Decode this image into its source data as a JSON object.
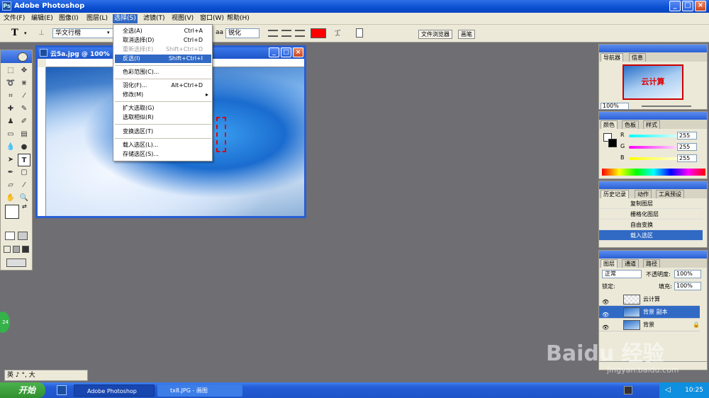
{
  "window": {
    "title": "Adobe Photoshop",
    "min": "_",
    "max": "□",
    "close": "×"
  },
  "menu": [
    "文件(F)",
    "编辑(E)",
    "图像(I)",
    "图层(L)",
    "选择(S)",
    "滤镜(T)",
    "视图(V)",
    "窗口(W)",
    "帮助(H)"
  ],
  "options": {
    "tool_glyph": "T",
    "font_family": "华文行楷",
    "antialias_label": "aa",
    "antialias": "锐化",
    "file_browser_tab": "文件浏览器",
    "brushes_tab": "画笔",
    "text_color": "#ff0000"
  },
  "document": {
    "title": "云5a.jpg @ 100%"
  },
  "select_menu": [
    {
      "label": "全选(A)",
      "shortcut": "Ctrl+A",
      "state": "normal"
    },
    {
      "label": "取消选择(D)",
      "shortcut": "Ctrl+D",
      "state": "normal"
    },
    {
      "label": "重新选择(E)",
      "shortcut": "Shift+Ctrl+D",
      "state": "disabled"
    },
    {
      "label": "反选(I)",
      "shortcut": "Shift+Ctrl+I",
      "state": "highlighted"
    },
    {
      "label": "色彩范围(C)...",
      "shortcut": "",
      "state": "normal"
    },
    {
      "label": "羽化(F)...",
      "shortcut": "Alt+Ctrl+D",
      "state": "normal"
    },
    {
      "label": "修改(M)",
      "shortcut": "▸",
      "state": "normal"
    },
    {
      "label": "扩大选取(G)",
      "shortcut": "",
      "state": "normal"
    },
    {
      "label": "选取相似(R)",
      "shortcut": "",
      "state": "normal"
    },
    {
      "label": "变换选区(T)",
      "shortcut": "",
      "state": "normal"
    },
    {
      "label": "载入选区(L)...",
      "shortcut": "",
      "state": "normal"
    },
    {
      "label": "存储选区(S)...",
      "shortcut": "",
      "state": "normal"
    }
  ],
  "navigator": {
    "tab1": "导航器",
    "tab2": "信息",
    "zoom": "100%",
    "thumb_text": "云计算"
  },
  "color_panel": {
    "tabs": [
      "颜色",
      "色板",
      "样式"
    ],
    "channels": [
      {
        "name": "R",
        "value": "255"
      },
      {
        "name": "G",
        "value": "255"
      },
      {
        "name": "B",
        "value": "255"
      }
    ]
  },
  "history_panel": {
    "tabs": [
      "历史记录",
      "动作",
      "工具预设"
    ],
    "items": [
      "复制图层",
      "栅格化图层",
      "自由变换",
      "载入选区"
    ]
  },
  "layers_panel": {
    "tabs": [
      "图层",
      "通道",
      "路径"
    ],
    "blend_mode": "正常",
    "opacity_label": "不透明度:",
    "opacity": "100%",
    "lock_label": "锁定:",
    "fill_label": "填充:",
    "fill": "100%",
    "layers": [
      "云计算",
      "背景 副本",
      "背景"
    ]
  },
  "ime": {
    "text": "英 ♪ °, 大"
  },
  "taskbar": {
    "start": "开始",
    "tasks": [
      "Adobe Photoshop",
      "tx8.JPG - 画图"
    ],
    "clock": "10:25"
  },
  "badge": "24",
  "watermark": {
    "main": "Baidu 经验",
    "sub": "jingyan.baidu.com"
  }
}
